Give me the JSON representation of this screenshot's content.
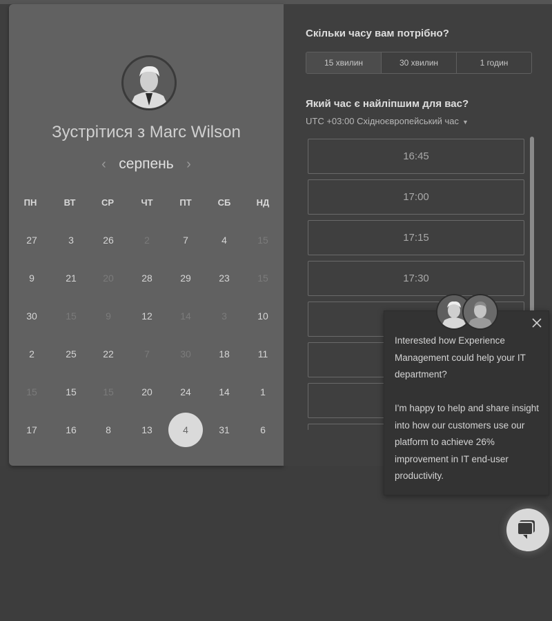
{
  "scheduler": {
    "meet_title": "Зустрітися з Marc Wilson",
    "month": "серпень",
    "prev_arrow": "‹",
    "next_arrow": "›",
    "weekdays": [
      "ПН",
      "ВТ",
      "СР",
      "ЧТ",
      "ПТ",
      "СБ",
      "НД"
    ],
    "days": [
      {
        "label": "27",
        "dim": false
      },
      {
        "label": "3",
        "dim": false
      },
      {
        "label": "26",
        "dim": false
      },
      {
        "label": "2",
        "dim": true
      },
      {
        "label": "7",
        "dim": false
      },
      {
        "label": "4",
        "dim": false
      },
      {
        "label": "15",
        "dim": true
      },
      {
        "label": "9",
        "dim": false
      },
      {
        "label": "21",
        "dim": false
      },
      {
        "label": "20",
        "dim": true
      },
      {
        "label": "28",
        "dim": false
      },
      {
        "label": "29",
        "dim": false
      },
      {
        "label": "23",
        "dim": false
      },
      {
        "label": "15",
        "dim": true
      },
      {
        "label": "30",
        "dim": false
      },
      {
        "label": "15",
        "dim": true
      },
      {
        "label": "9",
        "dim": true
      },
      {
        "label": "12",
        "dim": false
      },
      {
        "label": "14",
        "dim": true
      },
      {
        "label": "3",
        "dim": true
      },
      {
        "label": "10",
        "dim": false
      },
      {
        "label": "2",
        "dim": false
      },
      {
        "label": "25",
        "dim": false
      },
      {
        "label": "22",
        "dim": false
      },
      {
        "label": "7",
        "dim": true
      },
      {
        "label": "30",
        "dim": true
      },
      {
        "label": "18",
        "dim": false
      },
      {
        "label": "11",
        "dim": false
      },
      {
        "label": "15",
        "dim": true
      },
      {
        "label": "15",
        "dim": false
      },
      {
        "label": "15",
        "dim": true
      },
      {
        "label": "20",
        "dim": false
      },
      {
        "label": "24",
        "dim": false
      },
      {
        "label": "14",
        "dim": false
      },
      {
        "label": "1",
        "dim": false
      },
      {
        "label": "17",
        "dim": false
      },
      {
        "label": "16",
        "dim": false
      },
      {
        "label": "8",
        "dim": false
      },
      {
        "label": "13",
        "dim": false
      },
      {
        "label": "4",
        "dim": false,
        "selected": true
      },
      {
        "label": "31",
        "dim": false
      },
      {
        "label": "6",
        "dim": false
      }
    ],
    "duration_question": "Скільки часу вам потрібно?",
    "durations": [
      "15 хвилин",
      "30 хвилин",
      "1 годин"
    ],
    "time_question": "Який час є найліпшим для вас?",
    "timezone": "UTC +03:00 Східноєвропейський час",
    "time_slots": [
      "16:45",
      "17:00",
      "17:15",
      "17:30",
      "",
      "",
      "",
      ""
    ]
  },
  "chat_popup": {
    "message": "Interested how Experience Management could help your IT department?\n\nI'm happy to help and share insight into how our customers use our platform to achieve 26% improvement in IT end-user productivity."
  }
}
